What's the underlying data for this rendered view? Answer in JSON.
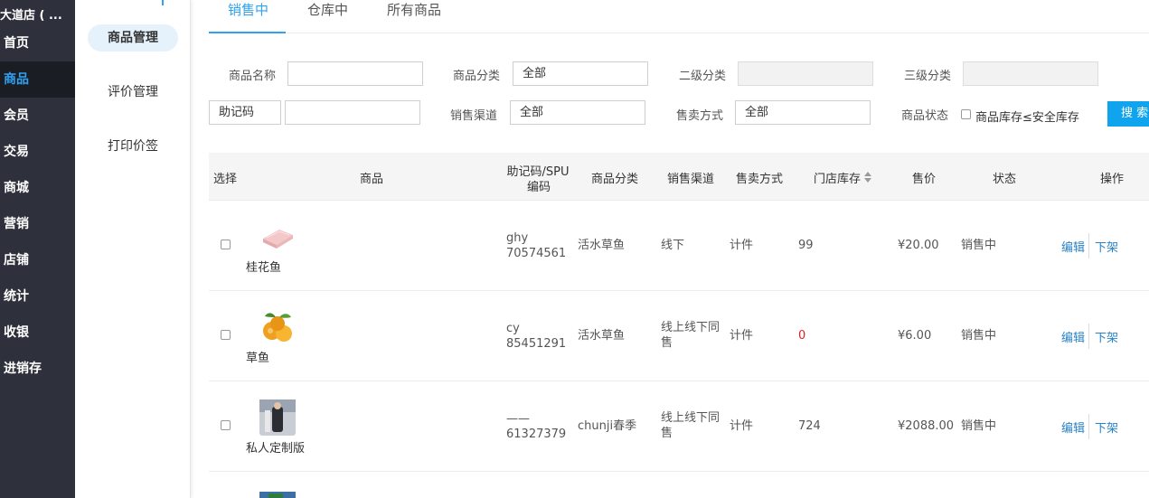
{
  "nav": {
    "store": "大道店 ( ...",
    "items": [
      "首页",
      "商品",
      "会员",
      "交易",
      "商城",
      "营销",
      "店铺",
      "统计",
      "收银",
      "进销存"
    ]
  },
  "subnav": {
    "items": [
      "商品管理",
      "评价管理",
      "打印价签"
    ]
  },
  "tabs": [
    "销售中",
    "仓库中",
    "所有商品"
  ],
  "filters": {
    "name_label": "商品名称",
    "category_label": "商品分类",
    "category_value": "全部",
    "level2_label": "二级分类",
    "level3_label": "三级分类",
    "mnemonic_select": "助记码",
    "channel_label": "销售渠道",
    "channel_value": "全部",
    "sale_mode_label": "售卖方式",
    "sale_mode_value": "全部",
    "status_label": "商品状态",
    "stock_check_label": "商品库存≤安全库存",
    "search_button": "搜 索"
  },
  "table": {
    "headers": {
      "select": "选择",
      "product": "商品",
      "code_line1": "助记码/SPU",
      "code_line2": "编码",
      "category": "商品分类",
      "channel": "销售渠道",
      "sale_mode": "售卖方式",
      "stock": "门店库存",
      "price": "售价",
      "status": "状态",
      "actions": "操作"
    },
    "rows": [
      {
        "name": "桂花鱼",
        "code1": "ghy",
        "code2": "70574561",
        "category": "活水草鱼",
        "channel1": "线下",
        "channel2": "",
        "sale_mode": "计件",
        "stock": "99",
        "price": "¥20.00",
        "status": "销售中",
        "edit": "编辑",
        "offshelf": "下架"
      },
      {
        "name": "草鱼",
        "code1": "cy",
        "code2": "85451291",
        "category": "活水草鱼",
        "channel1": "线上线下同",
        "channel2": "售",
        "sale_mode": "计件",
        "stock": "0",
        "price": "¥6.00",
        "status": "销售中",
        "edit": "编辑",
        "offshelf": "下架"
      },
      {
        "name": "私人定制版",
        "code1": "——",
        "code2": "61327379",
        "category": "chunji春季",
        "channel1": "线上线下同",
        "channel2": "售",
        "sale_mode": "计件",
        "stock": "724",
        "price": "¥2088.00",
        "status": "销售中",
        "edit": "编辑",
        "offshelf": "下架"
      }
    ]
  },
  "colors": {
    "accent": "#2fa2f2",
    "nav_bg": "#2e313b",
    "zero_stock": "#e02020",
    "link": "#2a82c6"
  }
}
